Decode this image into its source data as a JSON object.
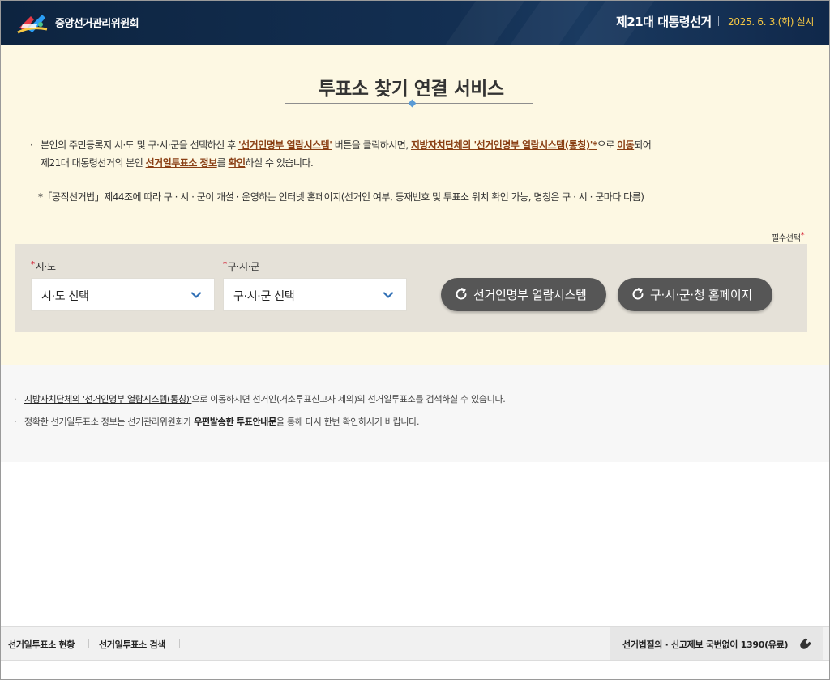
{
  "header": {
    "org_name": "중앙선거관리위원회",
    "election_title": "제21대 대통령선거",
    "election_date": "2025. 6. 3.(화) 실시"
  },
  "main": {
    "title": "투표소 찾기 연결 서비스",
    "desc1": {
      "bullet": "·",
      "t1": "본인의 주민등록지 시·도 및 구·시·군을 선택하신 후 ",
      "h1": "'선거인명부 열람시스템'",
      "t2": " 버튼을 클릭하시면, ",
      "h2": "지방자치단체의 '선거인명부 열람시스템(통칭)'*",
      "t3": "으로 ",
      "h3": "이동",
      "t4": "되어"
    },
    "desc2": {
      "t1": "제21대 대통령선거의 본인 ",
      "h1": "선거일투표소 정보",
      "t2": "를 ",
      "h2": "확인",
      "t3": "하실 수 있습니다."
    },
    "desc3": "*「공직선거법」제44조에 따라 구 · 시 · 군이 개설 · 운영하는 인터넷 홈페이지(선거인 여부, 등재번호 및 투표소 위치 확인 가능, 명칭은 구 · 시 · 군마다 다름)",
    "required_note": "필수선택",
    "required_star": "*"
  },
  "form": {
    "sido_label": "시·도",
    "sido_value": "시·도 선택",
    "gusi_label": "구·시·군",
    "gusi_value": "구·시·군 선택",
    "star": "*",
    "btn_register": "선거인명부 열람시스템",
    "btn_homepage": "구·시·군·청 홈페이지"
  },
  "notes": {
    "bullet": "·",
    "n1_link": "지방자치단체의 '선거인명부 열람시스템(통칭)'",
    "n1_text": "으로 이동하시면 선거인(거소투표신고자 제외)의 선거일투표소를 검색하실 수 있습니다.",
    "n2_t1": "정확한 선거일투표소 정보는 선거관리위원회가 ",
    "n2_link": "우편발송한 투표안내문",
    "n2_t2": "을 통해 다시 한번 확인하시기 바랍니다."
  },
  "footer": {
    "link1": "선거일투표소 현황",
    "link2": "선거일투표소 검색",
    "hotline": "선거법질의 · 신고제보 국번없이 1390(유료)"
  },
  "colors": {
    "header_bg": "#132f52",
    "date_accent": "#f6c844",
    "main_bg": "#fdf8e3",
    "highlight": "#8a3f14",
    "panel_bg": "#e5e1d8",
    "button_bg": "#565656",
    "required": "#d0021b"
  },
  "icons": [
    "election-logo-icon",
    "chevron-down-icon",
    "refresh-icon",
    "phone-icon"
  ]
}
